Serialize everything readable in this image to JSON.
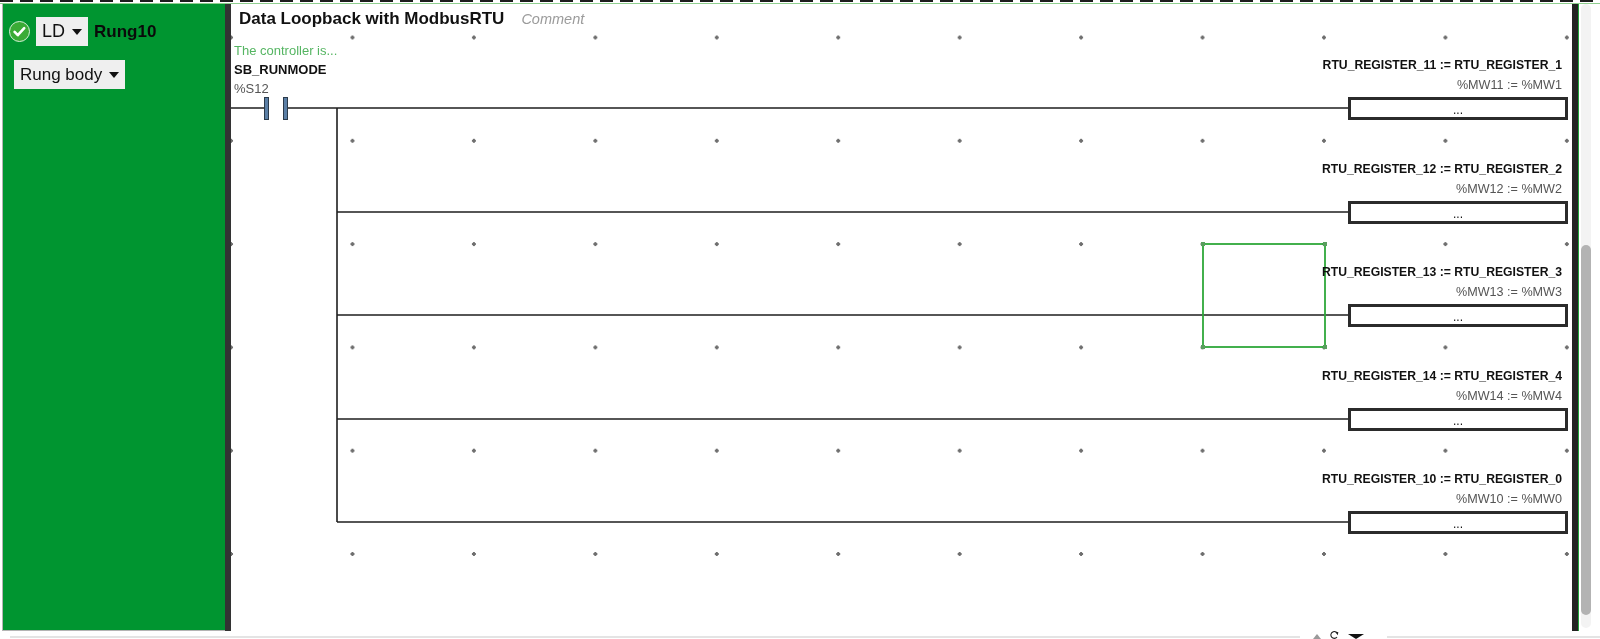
{
  "rung": {
    "valid": true,
    "language": "LD",
    "name": "Rung10",
    "section": "Rung body"
  },
  "header": {
    "title": "Data Loopback with ModbusRTU",
    "comment": {
      "placeholder": "Comment"
    }
  },
  "contact": {
    "comment": "The controller is...",
    "symbol": "SB_RUNMODE",
    "address": "%S12"
  },
  "operations": [
    {
      "expression": "RTU_REGISTER_11 := RTU_REGISTER_1",
      "address": "%MW11 := %MW1",
      "body": "...",
      "selected": false
    },
    {
      "expression": "RTU_REGISTER_12 := RTU_REGISTER_2",
      "address": "%MW12 := %MW2",
      "body": "...",
      "selected": false
    },
    {
      "expression": "RTU_REGISTER_13 := RTU_REGISTER_3",
      "address": "%MW13 := %MW3",
      "body": "...",
      "selected": true
    },
    {
      "expression": "RTU_REGISTER_14 := RTU_REGISTER_4",
      "address": "%MW14 := %MW4",
      "body": "...",
      "selected": false
    },
    {
      "expression": "RTU_REGISTER_10 := RTU_REGISTER_0",
      "address": "%MW10 := %MW0",
      "body": "...",
      "selected": false
    }
  ]
}
